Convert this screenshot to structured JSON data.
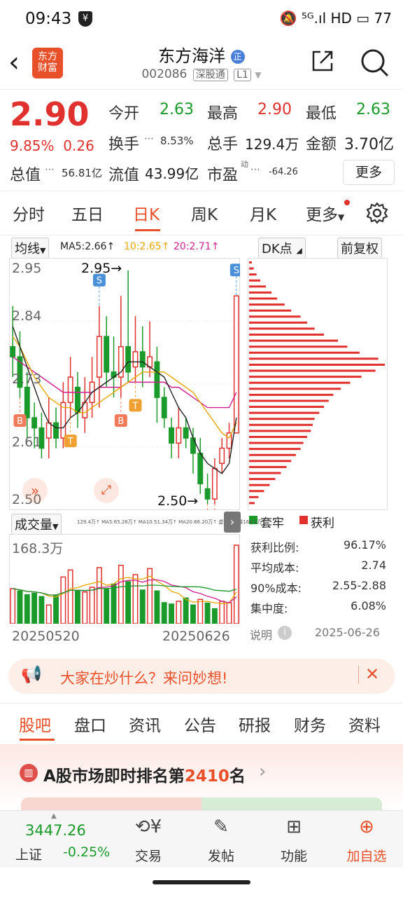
{
  "status": {
    "time": "09:43",
    "right": "🔕 ⁵ᴳ.ıl HD ▭ 77",
    "battery": "77"
  },
  "header": {
    "back": "<",
    "logo": "东方\n财富",
    "title": "东方海洋",
    "title_badge": "正",
    "code": "002086",
    "market": "深股通",
    "level": "L1"
  },
  "quote": {
    "price": "2.90",
    "pct": "9.85%",
    "chg": "0.26",
    "open_label": "今开",
    "open": "2.63",
    "high_label": "最高",
    "high": "2.90",
    "low_label": "最低",
    "low": "2.63",
    "turnover_label": "换手",
    "turnover": "8.53%",
    "volume_label": "总手",
    "volume": "129.4万",
    "amount_label": "金额",
    "amount": "3.70亿",
    "mktcap_label": "总值",
    "mktcap": "56.81亿",
    "float_label": "流值",
    "float": "43.99亿",
    "pe_label": "市盈",
    "pe_sup": "动",
    "pe": "-64.26",
    "more": "更多"
  },
  "period_tabs": [
    "分时",
    "五日",
    "日K",
    "周K",
    "月K",
    "更多"
  ],
  "chart_controls": {
    "ma_btn": "均线",
    "ma5": "MA5:2.66↑",
    "ma10": "10:2.65↑",
    "ma20": "20:2.71↑",
    "dk_btn": "DK点",
    "adjust_btn": "前复权"
  },
  "colors": {
    "up": "#e0312e",
    "down": "#1a9a2a",
    "accent": "#e8502a",
    "ma5": "#222222",
    "ma10": "#e8a800",
    "ma20": "#d02090"
  },
  "chart_data": [
    {
      "type": "candlestick",
      "ylim": [
        2.5,
        2.95
      ],
      "y_ticks": [
        "2.95",
        "2.84",
        "2.73",
        "2.61",
        "2.50"
      ],
      "candles": [
        [
          2.8,
          2.78,
          2.88,
          2.74
        ],
        [
          2.78,
          2.72,
          2.83,
          2.7
        ],
        [
          2.72,
          2.66,
          2.75,
          2.62
        ],
        [
          2.66,
          2.64,
          2.69,
          2.6
        ],
        [
          2.64,
          2.6,
          2.67,
          2.58
        ],
        [
          2.62,
          2.65,
          2.7,
          2.58
        ],
        [
          2.65,
          2.62,
          2.68,
          2.6
        ],
        [
          2.62,
          2.69,
          2.73,
          2.6
        ],
        [
          2.69,
          2.74,
          2.78,
          2.66
        ],
        [
          2.72,
          2.67,
          2.75,
          2.64
        ],
        [
          2.66,
          2.69,
          2.74,
          2.63
        ],
        [
          2.69,
          2.73,
          2.78,
          2.66
        ],
        [
          2.74,
          2.82,
          2.88,
          2.68
        ],
        [
          2.82,
          2.75,
          2.86,
          2.72
        ],
        [
          2.75,
          2.74,
          2.82,
          2.7
        ],
        [
          2.74,
          2.8,
          2.9,
          2.7
        ],
        [
          2.8,
          2.75,
          2.95,
          2.73
        ],
        [
          2.76,
          2.79,
          2.86,
          2.73
        ],
        [
          2.79,
          2.76,
          2.84,
          2.72
        ],
        [
          2.76,
          2.78,
          2.85,
          2.74
        ],
        [
          2.77,
          2.7,
          2.8,
          2.65
        ],
        [
          2.7,
          2.66,
          2.72,
          2.64
        ],
        [
          2.64,
          2.61,
          2.66,
          2.58
        ],
        [
          2.61,
          2.64,
          2.68,
          2.58
        ],
        [
          2.64,
          2.62,
          2.66,
          2.6
        ],
        [
          2.62,
          2.59,
          2.64,
          2.55
        ],
        [
          2.59,
          2.53,
          2.62,
          2.51
        ],
        [
          2.52,
          2.5,
          2.55,
          2.49
        ],
        [
          2.5,
          2.56,
          2.58,
          2.49
        ],
        [
          2.57,
          2.6,
          2.62,
          2.55
        ],
        [
          2.6,
          2.63,
          2.65,
          2.58
        ],
        [
          2.63,
          2.9,
          2.9,
          2.63
        ]
      ],
      "ma5": [
        2.84,
        2.8,
        2.76,
        2.72,
        2.68,
        2.65,
        2.64,
        2.64,
        2.66,
        2.67,
        2.69,
        2.71,
        2.72,
        2.73,
        2.74,
        2.75,
        2.77,
        2.77,
        2.77,
        2.76,
        2.75,
        2.74,
        2.71,
        2.68,
        2.66,
        2.62,
        2.59,
        2.57,
        2.56,
        2.55,
        2.57,
        2.66
      ],
      "ma10": [
        2.82,
        2.8,
        2.77,
        2.74,
        2.72,
        2.7,
        2.69,
        2.68,
        2.68,
        2.67,
        2.67,
        2.68,
        2.69,
        2.7,
        2.71,
        2.72,
        2.73,
        2.74,
        2.75,
        2.75,
        2.75,
        2.75,
        2.74,
        2.73,
        2.72,
        2.71,
        2.69,
        2.67,
        2.65,
        2.63,
        2.62,
        2.65
      ],
      "ma20": [
        2.78,
        2.77,
        2.76,
        2.75,
        2.74,
        2.73,
        2.72,
        2.71,
        2.71,
        2.71,
        2.71,
        2.71,
        2.72,
        2.72,
        2.72,
        2.72,
        2.73,
        2.73,
        2.73,
        2.73,
        2.73,
        2.73,
        2.72,
        2.72,
        2.71,
        2.7,
        2.69,
        2.68,
        2.68,
        2.68,
        2.68,
        2.71
      ],
      "annotations": {
        "high_label": "2.95→",
        "low_label": "2.50→"
      },
      "signals": [
        {
          "i": 1,
          "type": "B"
        },
        {
          "i": 8,
          "type": "T"
        },
        {
          "i": 12,
          "type": "S"
        },
        {
          "i": 15,
          "type": "B"
        },
        {
          "i": 17,
          "type": "T"
        },
        {
          "i": 27,
          "type": "B"
        },
        {
          "i": 28,
          "type": "B"
        },
        {
          "i": 31,
          "type": "S"
        }
      ]
    },
    {
      "type": "bar",
      "title": "成交量",
      "max_label": "168.3万",
      "ylim": [
        0,
        180
      ],
      "values": [
        75,
        70,
        62,
        65,
        58,
        40,
        60,
        100,
        115,
        70,
        68,
        78,
        120,
        75,
        85,
        125,
        90,
        105,
        72,
        118,
        70,
        45,
        42,
        48,
        55,
        40,
        52,
        44,
        32,
        48,
        45,
        168
      ],
      "up": [
        true,
        false,
        false,
        false,
        false,
        true,
        false,
        true,
        true,
        false,
        true,
        true,
        true,
        false,
        false,
        true,
        false,
        true,
        false,
        true,
        false,
        false,
        false,
        true,
        false,
        false,
        true,
        false,
        false,
        true,
        true,
        true
      ],
      "x_labels": [
        "20250520",
        "20250626"
      ],
      "ma_label": "129.4万↑ MA5:65.26万↑ MA10:51.34万↑ MA20:66.20万↑ 虚拟成交量168.3万"
    },
    {
      "type": "bar",
      "title": "筹码分布",
      "legend": [
        "套牢",
        "获利"
      ],
      "values": [
        3,
        5,
        8,
        12,
        18,
        24,
        30,
        38,
        45,
        55,
        62,
        70,
        80,
        95,
        105,
        118,
        138,
        145,
        135,
        120,
        108,
        98,
        90,
        85,
        80,
        75,
        70,
        68,
        66,
        62,
        58,
        55,
        50,
        45,
        40,
        34,
        28,
        22,
        16,
        10,
        6
      ]
    }
  ],
  "chip_stats": [
    {
      "label": "获利比例:",
      "value": "96.17%"
    },
    {
      "label": "平均成本:",
      "value": "2.74"
    },
    {
      "label": "90%成本:",
      "value": "2.55-2.88"
    },
    {
      "label": "集中度:",
      "value": "6.08%"
    }
  ],
  "chip_note": "说明",
  "chip_date": "2025-06-26",
  "banner": {
    "text": "大家在炒什么？来问妙想!",
    "close": "✕"
  },
  "bottom_tabs": [
    "股吧",
    "盘口",
    "资讯",
    "公告",
    "研报",
    "财务",
    "资料"
  ],
  "rank": {
    "prefix": "A股市场即时排名第",
    "num": "2410",
    "suffix": "名",
    "arrow": "›"
  },
  "footer": {
    "index_value": "3447.26",
    "index_name": "上证",
    "index_chg": "-0.25%",
    "trade": "交易",
    "post": "发帖",
    "func": "功能",
    "watch": "加自选"
  }
}
